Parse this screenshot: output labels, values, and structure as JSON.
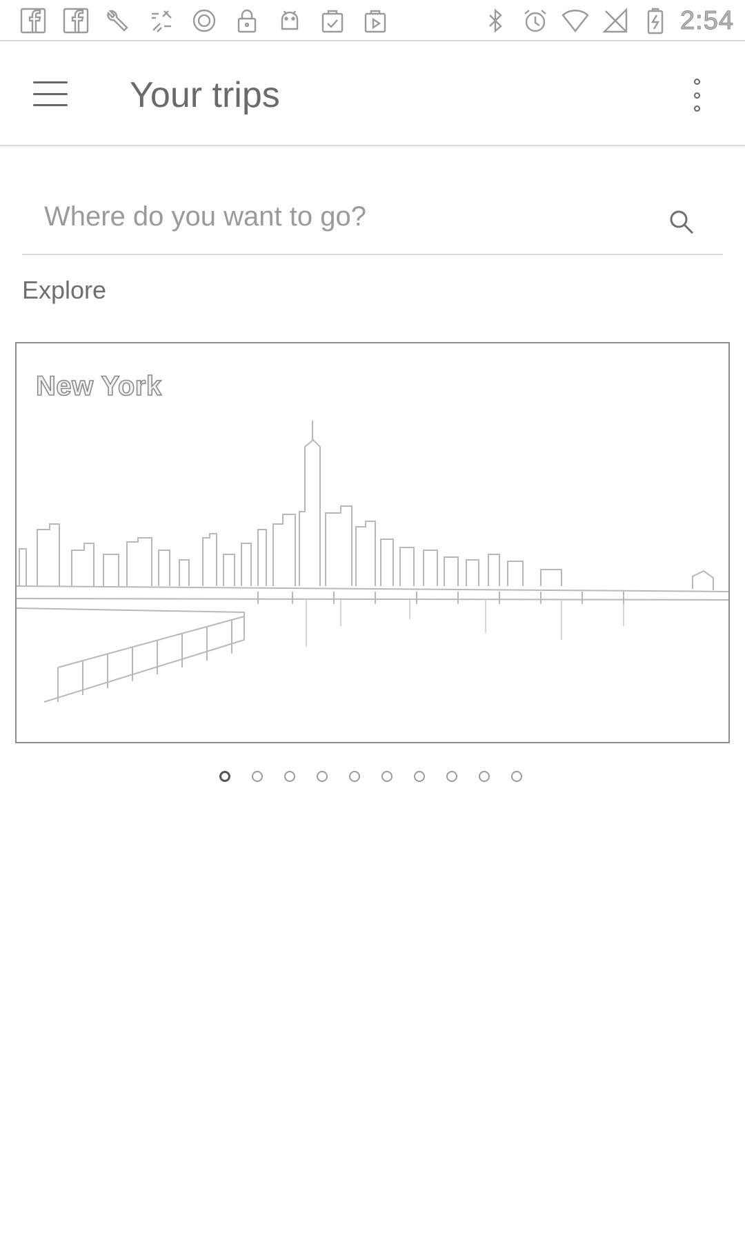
{
  "status_bar": {
    "left_icons": [
      "facebook-icon",
      "facebook-icon",
      "wrench-icon",
      "sync-icon",
      "circle-icon",
      "lock-icon",
      "android-icon",
      "clipboard-check-icon",
      "play-store-icon"
    ],
    "right_icons": [
      "bluetooth-icon",
      "alarm-icon",
      "wifi-icon",
      "no-signal-icon",
      "battery-charging-icon"
    ],
    "time": "2:54"
  },
  "app_bar": {
    "title": "Your trips",
    "menu_icon": "menu-icon",
    "overflow_icon": "more-vert-icon"
  },
  "search": {
    "placeholder": "Where do you want to go?",
    "value": "",
    "icon": "search-icon"
  },
  "explore": {
    "label": "Explore",
    "cards": [
      {
        "title": "New York",
        "image": "new-york-skyline"
      }
    ],
    "pager": {
      "count": 10,
      "active_index": 0
    }
  }
}
